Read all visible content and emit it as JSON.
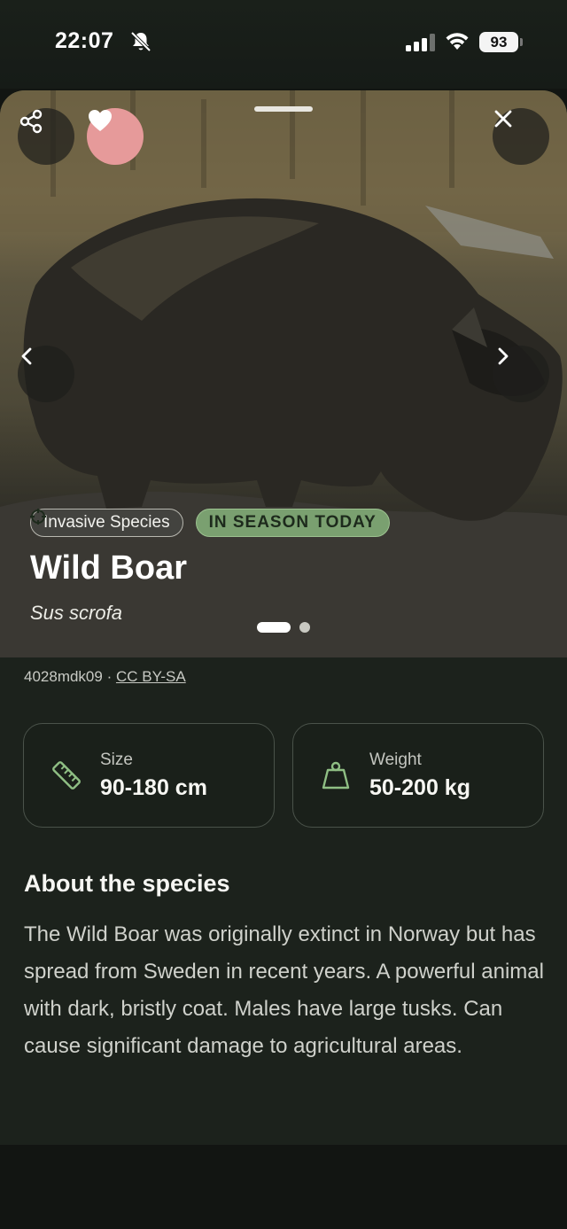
{
  "status_bar": {
    "time": "22:07",
    "battery": "93",
    "icons": [
      "bell-off-icon",
      "signal-icon",
      "wifi-icon",
      "battery-icon"
    ]
  },
  "hero": {
    "icons": [
      "share-icon",
      "heart-icon",
      "close-icon",
      "chevron-left-icon",
      "chevron-right-icon",
      "crosshair-icon"
    ],
    "tags": {
      "invasive": "Invasive Species",
      "season": "IN SEASON TODAY"
    },
    "name": "Wild Boar",
    "latin": "Sus scrofa",
    "image_count": 2,
    "active_image": 1
  },
  "credit": {
    "author": "4028mdk09 ·",
    "license": "CC BY-SA"
  },
  "stats": {
    "size": {
      "label": "Size",
      "value": "90-180 cm",
      "icon": "ruler-icon"
    },
    "weight": {
      "label": "Weight",
      "value": "50-200 kg",
      "icon": "weight-icon"
    }
  },
  "about": {
    "title": "About the species",
    "text": "The Wild Boar was originally extinct in Norway but has spread from Sweden in recent years. A powerful animal with dark, bristly coat. Males have large tusks. Can cause significant damage to agricultural areas."
  },
  "colors": {
    "background": "#121512",
    "sheet": "#1c221c",
    "season_tag": "#7aa070",
    "favorite": "#e69a9a",
    "stat_icon": "#8fbf84"
  }
}
